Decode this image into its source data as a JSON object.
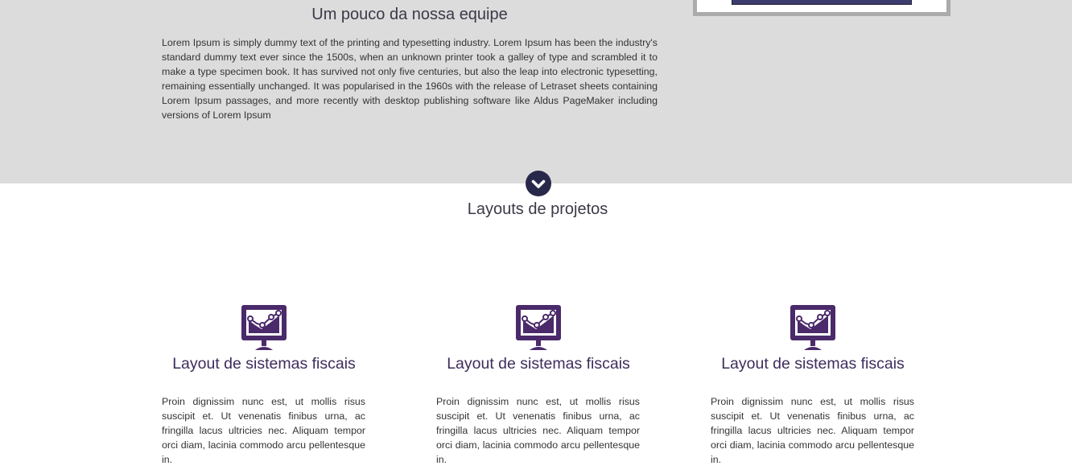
{
  "about": {
    "title": "Um pouco da nossa equipe",
    "text": "Lorem Ipsum is simply dummy text of the printing and typesetting industry. Lorem Ipsum has been the industry's standard dummy text ever since the 1500s, when an unknown printer took a galley of type and scrambled it to make a type specimen book. It has survived not only five centuries, but also the leap into electronic typesetting, remaining essentially unchanged. It was popularised in the 1960s with the release of Letraset sheets containing Lorem Ipsum passages, and more recently with desktop publishing software like Aldus PageMaker including versions of Lorem Ipsum"
  },
  "scroll_button": {
    "icon": "chevron-down-icon"
  },
  "projects": {
    "title": "Layouts de projetos",
    "cards": [
      {
        "icon": "monitor-chart-icon",
        "title": "Layout de sistemas fiscais",
        "text": "Proin dignissim nunc est, ut mollis risus suscipit et. Ut venenatis finibus urna, ac fringilla lacus ultricies nec. Aliquam tempor orci diam, lacinia commodo arcu pellentesque in."
      },
      {
        "icon": "monitor-chart-icon",
        "title": "Layout de sistemas fiscais",
        "text": "Proin dignissim nunc est, ut mollis risus suscipit et. Ut venenatis finibus urna, ac fringilla lacus ultricies nec. Aliquam tempor orci diam, lacinia commodo arcu pellentesque in."
      },
      {
        "icon": "monitor-chart-icon",
        "title": "Layout de sistemas fiscais",
        "text": "Proin dignissim nunc est, ut mollis risus suscipit et. Ut venenatis finibus urna, ac fringilla lacus ultricies nec. Aliquam tempor orci diam, lacinia commodo arcu pellentesque in."
      }
    ]
  },
  "colors": {
    "about_background": "#dcdcdc",
    "accent_dark": "#28294a",
    "icon_purple": "#4a2a6a",
    "card_title": "#3d2d5c"
  }
}
